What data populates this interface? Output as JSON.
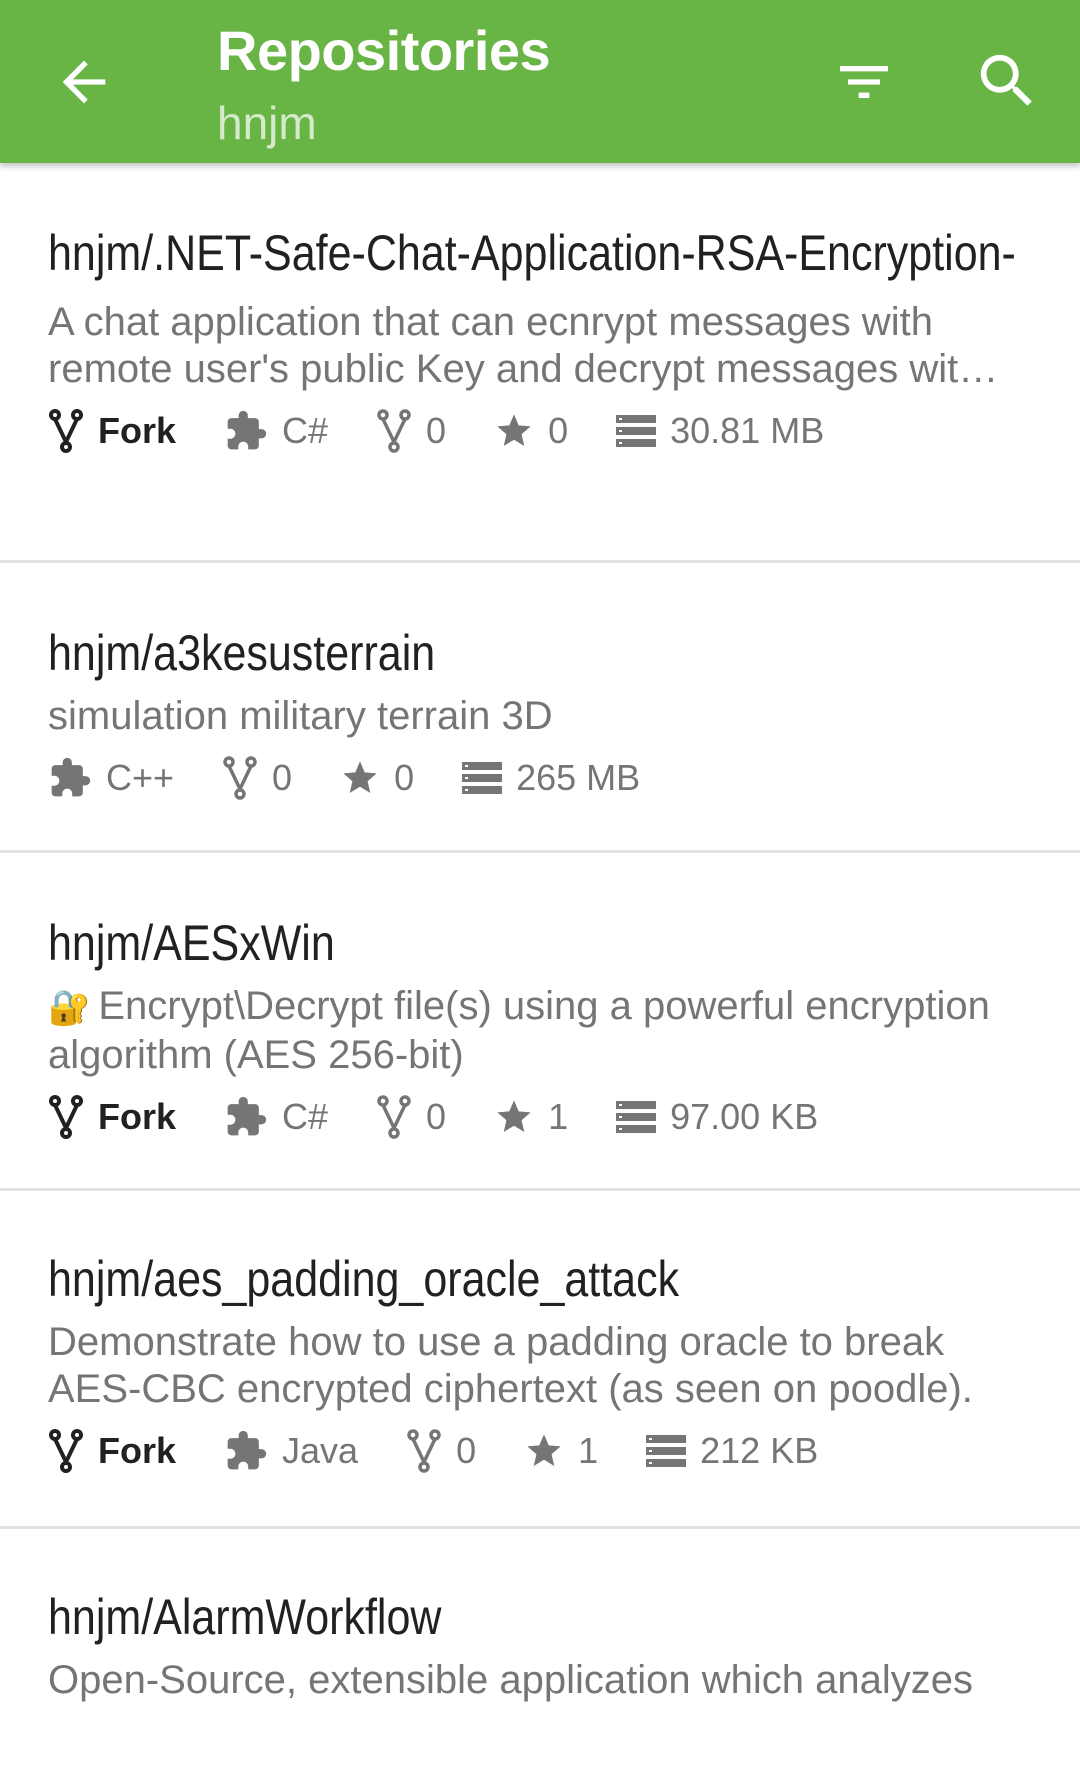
{
  "appbar": {
    "title": "Repositories",
    "subtitle": "hnjm",
    "back_icon": "arrow-back-icon",
    "filter_icon": "filter-icon",
    "search_icon": "search-icon",
    "color": "#68b545"
  },
  "repos": [
    {
      "name": "hnjm/.NET-Safe-Chat-Application-RSA-Encryption-",
      "description": "A chat application that can ecnrypt messages with remote user's public Key and decrypt messages wit…",
      "fork_label": "Fork",
      "language": "C#",
      "forks": "0",
      "stars": "0",
      "size": "30.81 MB"
    },
    {
      "name": "hnjm/a3kesusterrain",
      "description": "simulation military terrain 3D",
      "language": "C++",
      "forks": "0",
      "stars": "0",
      "size": "265 MB"
    },
    {
      "name": "hnjm/AESxWin",
      "description_emoji": "🔐",
      "description": "Encrypt\\Decrypt file(s) using a powerful encryption algorithm (AES 256-bit)",
      "fork_label": "Fork",
      "language": "C#",
      "forks": "0",
      "stars": "1",
      "size": "97.00 KB"
    },
    {
      "name": "hnjm/aes_padding_oracle_attack",
      "description": "Demonstrate how to use a padding oracle to break AES-CBC encrypted ciphertext (as seen on poodle).",
      "fork_label": "Fork",
      "language": "Java",
      "forks": "0",
      "stars": "1",
      "size": "212 KB"
    },
    {
      "name": "hnjm/AlarmWorkflow",
      "description": "Open-Source, extensible application which analyzes"
    }
  ]
}
